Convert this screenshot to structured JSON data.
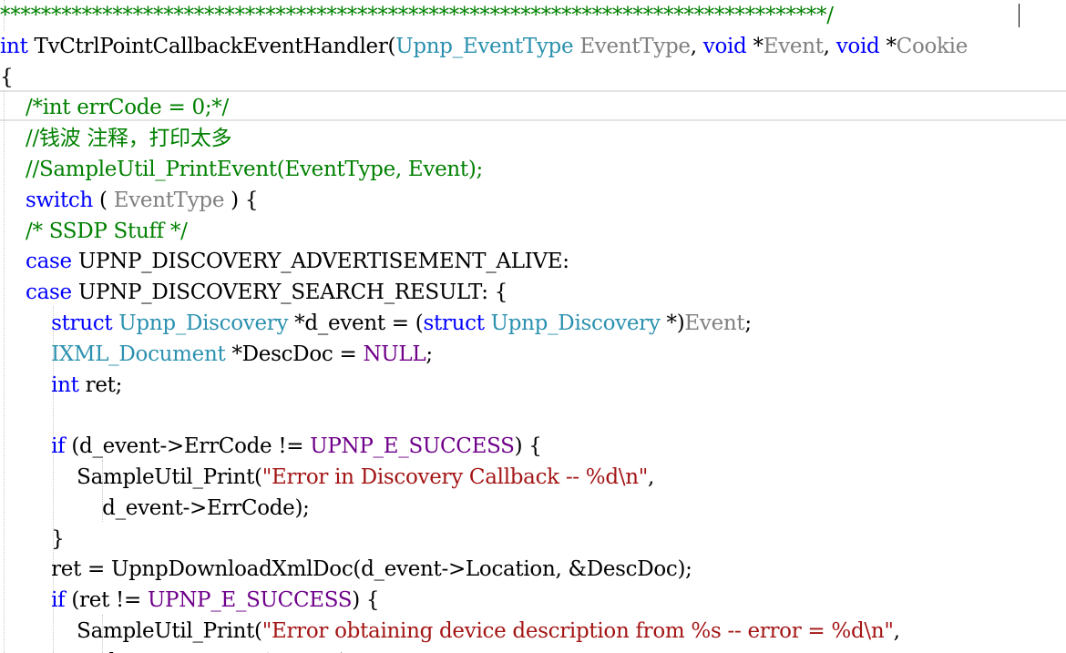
{
  "editor": {
    "colors": {
      "background": "#ffffff",
      "plain": "#000000",
      "comment": "#008000",
      "keyword": "#0000ff",
      "type": "#2b91af",
      "param": "#808080",
      "macro": "#6f008a",
      "string": "#a31515",
      "current_line_border": "#e3e3e3"
    },
    "lines": [
      [
        {
          "t": "*********************************************************************************/",
          "c": "comment"
        }
      ],
      [
        {
          "t": "int",
          "c": "keyword"
        },
        {
          "t": " TvCtrlPointCallbackEventHandler(",
          "c": "plain"
        },
        {
          "t": "Upnp_EventType",
          "c": "type"
        },
        {
          "t": " ",
          "c": "plain"
        },
        {
          "t": "EventType",
          "c": "param"
        },
        {
          "t": ", ",
          "c": "plain"
        },
        {
          "t": "void",
          "c": "keyword"
        },
        {
          "t": " *",
          "c": "plain"
        },
        {
          "t": "Event",
          "c": "param"
        },
        {
          "t": ", ",
          "c": "plain"
        },
        {
          "t": "void",
          "c": "keyword"
        },
        {
          "t": " *",
          "c": "plain"
        },
        {
          "t": "Cookie",
          "c": "param"
        }
      ],
      [
        {
          "t": "{",
          "c": "plain"
        }
      ],
      [
        {
          "t": "    /*int errCode = 0;*/",
          "c": "comment"
        }
      ],
      [
        {
          "t": "    //钱波 注释，打印太多",
          "c": "comment"
        }
      ],
      [
        {
          "t": "    //SampleUtil_PrintEvent(EventType, Event);",
          "c": "comment"
        }
      ],
      [
        {
          "t": "    ",
          "c": "plain"
        },
        {
          "t": "switch",
          "c": "keyword"
        },
        {
          "t": " ( ",
          "c": "plain"
        },
        {
          "t": "EventType",
          "c": "param"
        },
        {
          "t": " ) {",
          "c": "plain"
        }
      ],
      [
        {
          "t": "    /* SSDP Stuff */",
          "c": "comment"
        }
      ],
      [
        {
          "t": "    ",
          "c": "plain"
        },
        {
          "t": "case",
          "c": "keyword"
        },
        {
          "t": " UPNP_DISCOVERY_ADVERTISEMENT_ALIVE:",
          "c": "plain"
        }
      ],
      [
        {
          "t": "    ",
          "c": "plain"
        },
        {
          "t": "case",
          "c": "keyword"
        },
        {
          "t": " UPNP_DISCOVERY_SEARCH_RESULT: {",
          "c": "plain"
        }
      ],
      [
        {
          "t": "        ",
          "c": "plain"
        },
        {
          "t": "struct",
          "c": "keyword"
        },
        {
          "t": " ",
          "c": "plain"
        },
        {
          "t": "Upnp_Discovery",
          "c": "type"
        },
        {
          "t": " *d_event = (",
          "c": "plain"
        },
        {
          "t": "struct",
          "c": "keyword"
        },
        {
          "t": " ",
          "c": "plain"
        },
        {
          "t": "Upnp_Discovery",
          "c": "type"
        },
        {
          "t": " *)",
          "c": "plain"
        },
        {
          "t": "Event",
          "c": "param"
        },
        {
          "t": ";",
          "c": "plain"
        }
      ],
      [
        {
          "t": "        ",
          "c": "plain"
        },
        {
          "t": "IXML_Document",
          "c": "type"
        },
        {
          "t": " *DescDoc = ",
          "c": "plain"
        },
        {
          "t": "NULL",
          "c": "macro"
        },
        {
          "t": ";",
          "c": "plain"
        }
      ],
      [
        {
          "t": "        ",
          "c": "plain"
        },
        {
          "t": "int",
          "c": "keyword"
        },
        {
          "t": " ret;",
          "c": "plain"
        }
      ],
      [
        {
          "t": "",
          "c": "plain"
        }
      ],
      [
        {
          "t": "        ",
          "c": "plain"
        },
        {
          "t": "if",
          "c": "keyword"
        },
        {
          "t": " (d_event->ErrCode != ",
          "c": "plain"
        },
        {
          "t": "UPNP_E_SUCCESS",
          "c": "macro"
        },
        {
          "t": ") {",
          "c": "plain"
        }
      ],
      [
        {
          "t": "            SampleUtil_Print(",
          "c": "plain"
        },
        {
          "t": "\"Error in Discovery Callback -- %d\\n\"",
          "c": "string"
        },
        {
          "t": ",",
          "c": "plain"
        }
      ],
      [
        {
          "t": "                d_event->ErrCode);",
          "c": "plain"
        }
      ],
      [
        {
          "t": "        }",
          "c": "plain"
        }
      ],
      [
        {
          "t": "        ret = UpnpDownloadXmlDoc(d_event->Location, &DescDoc);",
          "c": "plain"
        }
      ],
      [
        {
          "t": "        ",
          "c": "plain"
        },
        {
          "t": "if",
          "c": "keyword"
        },
        {
          "t": " (ret != ",
          "c": "plain"
        },
        {
          "t": "UPNP_E_SUCCESS",
          "c": "macro"
        },
        {
          "t": ") {",
          "c": "plain"
        }
      ],
      [
        {
          "t": "            SampleUtil_Print(",
          "c": "plain"
        },
        {
          "t": "\"Error obtaining device description from %s -- error = %d\\n\"",
          "c": "string"
        },
        {
          "t": ",",
          "c": "plain"
        }
      ],
      [
        {
          "t": "                d_event->Location, ret);",
          "c": "plain"
        }
      ]
    ]
  }
}
